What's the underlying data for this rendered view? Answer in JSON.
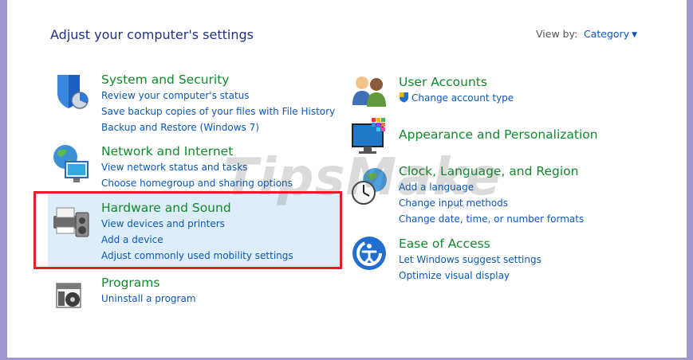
{
  "header": {
    "title": "Adjust your computer's settings",
    "view_by_label": "View by:",
    "view_by_value": "Category"
  },
  "categories": [
    {
      "id": "system-security",
      "icon": "shield-icon",
      "title": "System and Security",
      "links": [
        "Review your computer's status",
        "Save backup copies of your files with File History",
        "Backup and Restore (Windows 7)"
      ]
    },
    {
      "id": "network-internet",
      "icon": "network-globe-icon",
      "title": "Network and Internet",
      "links": [
        "View network status and tasks",
        "Choose homegroup and sharing options"
      ]
    },
    {
      "id": "hardware-sound",
      "icon": "printer-speaker-icon",
      "title": "Hardware and Sound",
      "links": [
        "View devices and printers",
        "Add a device",
        "Adjust commonly used mobility settings"
      ]
    },
    {
      "id": "programs",
      "icon": "programs-box-icon",
      "title": "Programs",
      "links": [
        "Uninstall a program"
      ]
    },
    {
      "id": "user-accounts",
      "icon": "users-icon",
      "title": "User Accounts",
      "links": [
        "Change account type"
      ]
    },
    {
      "id": "appearance",
      "icon": "monitor-palette-icon",
      "title": "Appearance and Personalization",
      "links": []
    },
    {
      "id": "clock-language",
      "icon": "clock-globe-icon",
      "title": "Clock, Language, and Region",
      "links": [
        "Add a language",
        "Change input methods",
        "Change date, time, or number formats"
      ]
    },
    {
      "id": "ease-access",
      "icon": "ease-of-access-icon",
      "title": "Ease of Access",
      "links": [
        "Let Windows suggest settings",
        "Optimize visual display"
      ]
    }
  ],
  "watermark": {
    "text": "TipsMake",
    "sub": ".com"
  },
  "colors": {
    "accent_link": "#0a59b8",
    "category_title": "#118a2c",
    "highlight_border": "#e11f26",
    "highlight_fill": "#deedfa"
  }
}
